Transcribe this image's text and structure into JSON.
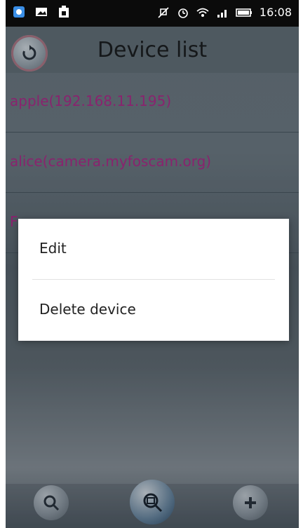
{
  "status_bar": {
    "time": "16:08",
    "left_icons": [
      "app-icon",
      "image-icon",
      "notification-icon"
    ],
    "right_icons": [
      "mute-icon",
      "alarm-icon",
      "wifi-icon",
      "signal-icon",
      "battery-icon"
    ]
  },
  "header": {
    "title": "Device list",
    "back_icon": "refresh-icon"
  },
  "device_list": {
    "items": [
      {
        "label": "apple(192.168.11.195)"
      },
      {
        "label": "alice(camera.myfoscam.org)"
      },
      {
        "label": "F"
      }
    ]
  },
  "context_menu": {
    "items": [
      {
        "label": "Edit"
      },
      {
        "label": "Delete device"
      }
    ]
  },
  "bottom_bar": {
    "buttons": [
      "search-icon",
      "scan-icon",
      "add-icon"
    ]
  },
  "colors": {
    "item_text": "#b02d8e",
    "title_text": "#1c1f22"
  }
}
